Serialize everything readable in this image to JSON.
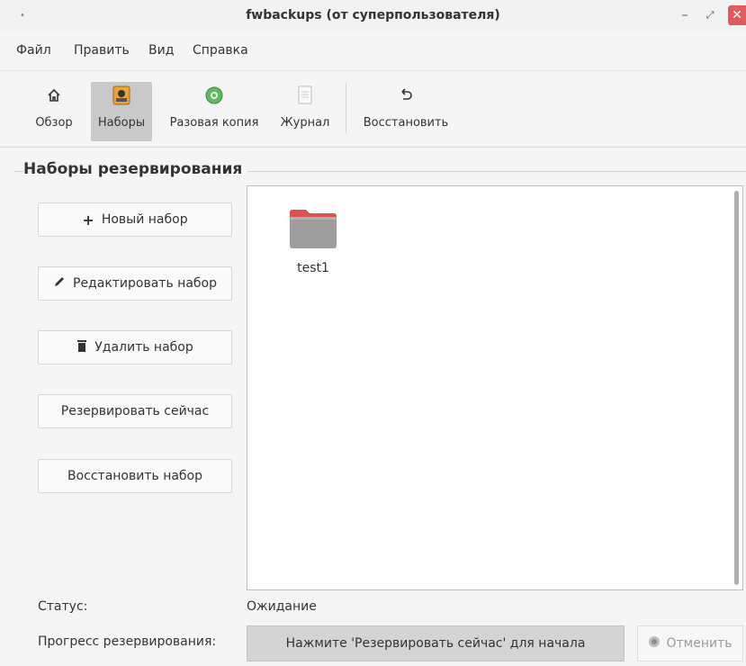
{
  "window": {
    "title": "fwbackups (от суперпользователя)",
    "menu_dot": "•",
    "minimize": "–",
    "maximize": "⤢",
    "close": "✕"
  },
  "menu": [
    "Файл",
    "Править",
    "Вид",
    "Справка"
  ],
  "toolbar": [
    {
      "label": "Обзор",
      "icon": "home-icon"
    },
    {
      "label": "Наборы",
      "icon": "sets-icon",
      "active": true
    },
    {
      "label": "Разовая копия",
      "icon": "one-time-backup-icon"
    },
    {
      "label": "Журнал",
      "icon": "log-icon"
    },
    {
      "label": "Восстановить",
      "icon": "restore-icon"
    }
  ],
  "section": {
    "title": "Наборы резервирования"
  },
  "buttons": {
    "new_set": "Новый набор",
    "edit_set": "Редактировать набор",
    "delete_set": "Удалить набор",
    "backup_now": "Резервировать сейчас",
    "restore_set": "Восстановить набор"
  },
  "sets": [
    {
      "name": "test1",
      "icon": "folder-icon"
    }
  ],
  "status": {
    "label": "Статус:",
    "value": "Ожидание",
    "progress_label": "Прогресс резервирования:",
    "progress_text": "Нажмите 'Резервировать сейчас' для начала",
    "cancel": "Отменить"
  },
  "colors": {
    "close_button": "#e05c5c",
    "folder_tab": "#d9534f",
    "folder_body": "#9e9e9e",
    "active_tool": "#c9c9c9"
  }
}
